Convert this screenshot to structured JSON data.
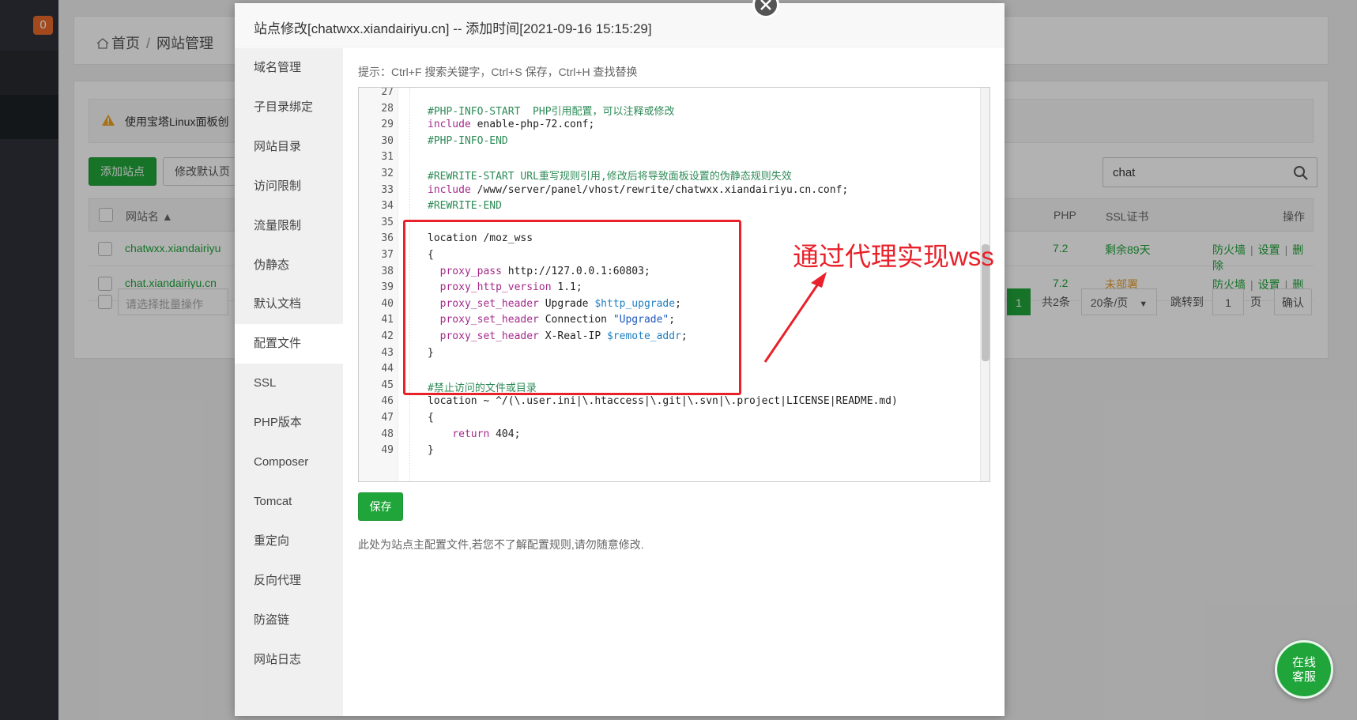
{
  "nav": {
    "badge": "0"
  },
  "breadcrumb": {
    "home": "首页",
    "separator": "/",
    "current": "网站管理"
  },
  "warning": {
    "text": "使用宝塔Linux面板创"
  },
  "toolbar": {
    "add_site": "添加站点",
    "modify_default": "修改默认页"
  },
  "search": {
    "value": "chat"
  },
  "table": {
    "headers": {
      "name": "网站名 ▲",
      "php": "PHP",
      "ssl": "SSL证书",
      "actions": "操作"
    },
    "rows": [
      {
        "name": "chatwxx.xiandairiyu",
        "php": "7.2",
        "ssl": "剩余89天",
        "firewall": "防火墙",
        "settings": "设置",
        "delete": "删除"
      },
      {
        "name": "chat.xiandairiyu.cn",
        "php": "7.2",
        "ssl": "未部署",
        "firewall": "防火墙",
        "settings": "设置",
        "delete": "删除"
      }
    ],
    "action_sep": "|"
  },
  "batch": {
    "placeholder": "请选择批量操作"
  },
  "pager": {
    "current": "1",
    "total": "共2条",
    "per_page": "20条/页",
    "goto": "跳转到",
    "goto_value": "1",
    "page_unit": "页",
    "confirm": "确认"
  },
  "modal": {
    "title": "站点修改[chatwxx.xiandairiyu.cn] -- 添加时间[2021-09-16 15:15:29]",
    "sidebar": [
      "域名管理",
      "子目录绑定",
      "网站目录",
      "访问限制",
      "流量限制",
      "伪静态",
      "默认文档",
      "配置文件",
      "SSL",
      "PHP版本",
      "Composer",
      "Tomcat",
      "重定向",
      "反向代理",
      "防盗链",
      "网站日志"
    ],
    "active_index": 7,
    "hint": "提示：Ctrl+F 搜索关键字，Ctrl+S 保存，Ctrl+H 查找替换",
    "save": "保存",
    "note": "此处为站点主配置文件,若您不了解配置规则,请勿随意修改."
  },
  "editor": {
    "lines": [
      {
        "n": "27",
        "parts": []
      },
      {
        "n": "28",
        "parts": [
          {
            "t": "#PHP-INFO-START  PHP引用配置，可以注释或修改",
            "c": "comment"
          }
        ]
      },
      {
        "n": "29",
        "parts": [
          {
            "t": "include",
            "c": "kw"
          },
          {
            "t": " enable-php-72.conf;",
            "c": "plain"
          }
        ]
      },
      {
        "n": "30",
        "parts": [
          {
            "t": "#PHP-INFO-END",
            "c": "comment"
          }
        ]
      },
      {
        "n": "31",
        "parts": []
      },
      {
        "n": "32",
        "parts": [
          {
            "t": "#REWRITE-START URL重写规则引用,修改后将导致面板设置的伪静态规则失效",
            "c": "comment"
          }
        ]
      },
      {
        "n": "33",
        "parts": [
          {
            "t": "include",
            "c": "kw"
          },
          {
            "t": " /www/server/panel/vhost/rewrite/chatwxx.xiandairiyu.cn.conf;",
            "c": "plain"
          }
        ]
      },
      {
        "n": "34",
        "parts": [
          {
            "t": "#REWRITE-END",
            "c": "comment"
          }
        ]
      },
      {
        "n": "35",
        "parts": []
      },
      {
        "n": "36",
        "parts": [
          {
            "t": "location /moz_wss",
            "c": "plain"
          }
        ]
      },
      {
        "n": "37",
        "parts": [
          {
            "t": "{",
            "c": "plain"
          }
        ]
      },
      {
        "n": "38",
        "parts": [
          {
            "t": "  proxy_pass",
            "c": "kw"
          },
          {
            "t": " http://127.0.0.1:60803;",
            "c": "plain"
          }
        ]
      },
      {
        "n": "39",
        "parts": [
          {
            "t": "  proxy_http_version",
            "c": "kw"
          },
          {
            "t": " 1.1;",
            "c": "plain"
          }
        ]
      },
      {
        "n": "40",
        "parts": [
          {
            "t": "  proxy_set_header",
            "c": "kw"
          },
          {
            "t": " Upgrade ",
            "c": "plain"
          },
          {
            "t": "$http_upgrade",
            "c": "var"
          },
          {
            "t": ";",
            "c": "plain"
          }
        ]
      },
      {
        "n": "41",
        "parts": [
          {
            "t": "  proxy_set_header",
            "c": "kw"
          },
          {
            "t": " Connection ",
            "c": "plain"
          },
          {
            "t": "\"Upgrade\"",
            "c": "str"
          },
          {
            "t": ";",
            "c": "plain"
          }
        ]
      },
      {
        "n": "42",
        "parts": [
          {
            "t": "  proxy_set_header",
            "c": "kw"
          },
          {
            "t": " X-Real-IP ",
            "c": "plain"
          },
          {
            "t": "$remote_addr",
            "c": "var"
          },
          {
            "t": ";",
            "c": "plain"
          }
        ]
      },
      {
        "n": "43",
        "parts": [
          {
            "t": "}",
            "c": "plain"
          }
        ]
      },
      {
        "n": "44",
        "parts": []
      },
      {
        "n": "45",
        "parts": [
          {
            "t": "#禁止访问的文件或目录",
            "c": "comment"
          }
        ]
      },
      {
        "n": "46",
        "parts": [
          {
            "t": "location ~ ^/(\\.user.ini|\\.htaccess|\\.git|\\.svn|\\.project|LICENSE|README.md)",
            "c": "plain"
          }
        ]
      },
      {
        "n": "47",
        "parts": [
          {
            "t": "{",
            "c": "plain"
          }
        ]
      },
      {
        "n": "48",
        "parts": [
          {
            "t": "    return",
            "c": "kw"
          },
          {
            "t": " 404;",
            "c": "plain"
          }
        ]
      },
      {
        "n": "49",
        "parts": [
          {
            "t": "}",
            "c": "plain"
          }
        ]
      }
    ]
  },
  "annotation": {
    "text": "通过代理实现wss"
  },
  "service": {
    "line1": "在线",
    "line2": "客服"
  },
  "colors": {
    "accent_green": "#20a53a",
    "annotation_red": "#e8212a",
    "sidebar_dark": "#2f3238"
  }
}
